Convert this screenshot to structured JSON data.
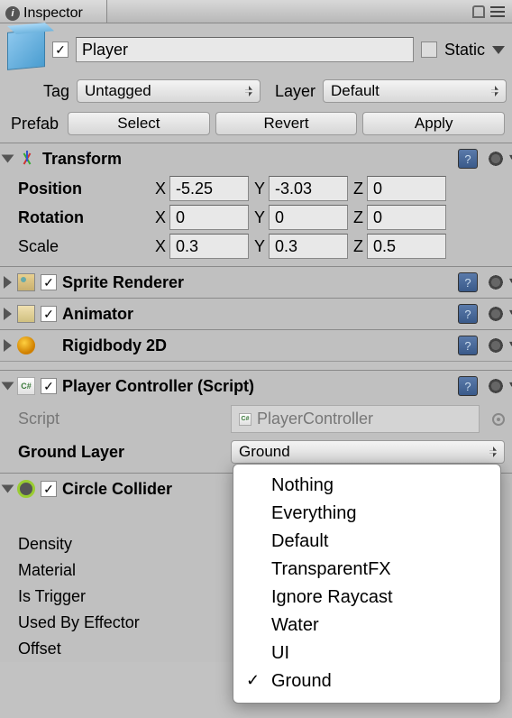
{
  "tab": {
    "title": "Inspector"
  },
  "object": {
    "name": "Player",
    "static_label": "Static"
  },
  "tag_row": {
    "tag_label": "Tag",
    "tag_value": "Untagged",
    "layer_label": "Layer",
    "layer_value": "Default"
  },
  "prefab": {
    "label": "Prefab",
    "select": "Select",
    "revert": "Revert",
    "apply": "Apply"
  },
  "transform": {
    "title": "Transform",
    "position_label": "Position",
    "rotation_label": "Rotation",
    "scale_label": "Scale",
    "x": "X",
    "y": "Y",
    "z": "Z",
    "pos": {
      "x": "-5.25",
      "y": "-3.03",
      "z": "0"
    },
    "rot": {
      "x": "0",
      "y": "0",
      "z": "0"
    },
    "scale": {
      "x": "0.3",
      "y": "0.3",
      "z": "0.5"
    }
  },
  "sprite_renderer": {
    "title": "Sprite Renderer"
  },
  "animator": {
    "title": "Animator"
  },
  "rigidbody": {
    "title": "Rigidbody 2D"
  },
  "player_controller": {
    "title": "Player Controller (Script)",
    "script_label": "Script",
    "script_value": "PlayerController",
    "ground_layer_label": "Ground Layer",
    "ground_layer_value": "Ground"
  },
  "circle_collider": {
    "title": "Circle Collider",
    "density_label": "Density",
    "material_label": "Material",
    "is_trigger_label": "Is Trigger",
    "used_by_effector_label": "Used By Effector",
    "offset_label": "Offset"
  },
  "layer_popup": {
    "items": [
      "Nothing",
      "Everything",
      "Default",
      "TransparentFX",
      "Ignore Raycast",
      "Water",
      "UI",
      "Ground"
    ],
    "selected": "Ground"
  }
}
